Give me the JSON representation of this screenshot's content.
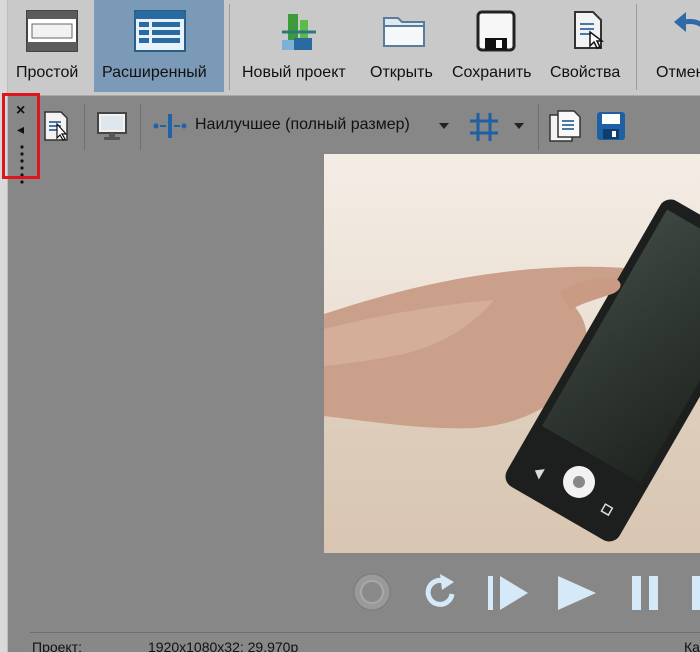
{
  "ribbon": {
    "buttons": [
      {
        "label": "Простой",
        "icon": "simple-layout-icon"
      },
      {
        "label": "Расширенный",
        "icon": "advanced-layout-icon",
        "active": true
      },
      {
        "label": "Новый проект",
        "icon": "new-project-icon"
      },
      {
        "label": "Открыть",
        "icon": "open-folder-icon"
      },
      {
        "label": "Сохранить",
        "icon": "save-icon"
      },
      {
        "label": "Свойства",
        "icon": "properties-icon"
      },
      {
        "label": "Отмен",
        "icon": "undo-icon"
      }
    ],
    "active_color": "#7b9ab7"
  },
  "dock_handle": {
    "close_glyph": "×",
    "collapse_glyph": "◂",
    "highlight_color": "#e0141e"
  },
  "preview_toolbar": {
    "quality_label": "Наилучшее (полный размер)",
    "icons": [
      "preview-properties-icon",
      "external-monitor-icon",
      "split-screen-icon",
      "grid-overlay-icon",
      "copy-snapshot-icon",
      "save-snapshot-icon"
    ]
  },
  "transport": {
    "buttons": [
      "record-button",
      "loop-button",
      "play-from-start-button",
      "play-button",
      "pause-button"
    ]
  },
  "status_bar": {
    "project_label": "Проект:",
    "project_value": "1920x1080x32; 29,970p",
    "right_truncated": "Ка"
  }
}
